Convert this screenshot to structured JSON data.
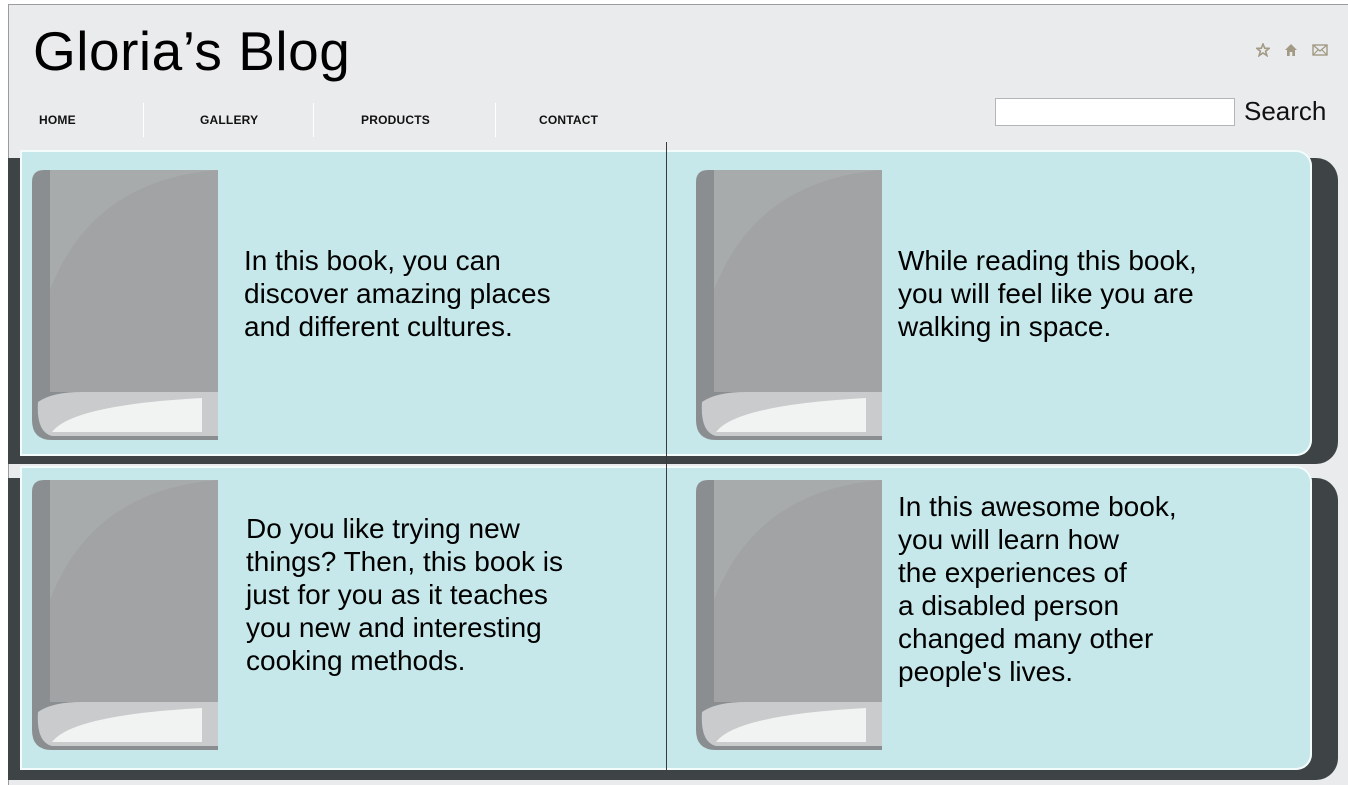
{
  "blog": {
    "title": "Gloria’s Blog"
  },
  "icons": [
    "star-icon",
    "home-icon",
    "mail-icon"
  ],
  "nav": {
    "items": [
      "HOME",
      "GALLERY",
      "PRODUCTS",
      "CONTACT"
    ]
  },
  "search": {
    "value": "",
    "placeholder": "",
    "button_label": "Search"
  },
  "cards": [
    {
      "text": "In this book, you can\ndiscover amazing places\nand different cultures."
    },
    {
      "text": "While reading this book,\nyou will feel like you are\nwalking in space."
    },
    {
      "text": "Do you like trying new\nthings? Then, this book is\njust for you as it teaches\nyou new and interesting\ncooking methods."
    },
    {
      "text": "In this awesome book,\nyou will learn how\nthe experiences of\na disabled person\nchanged many other\npeople's lives."
    }
  ],
  "colors": {
    "page_bg": "#eaebec",
    "card_bg": "#c6e8ea",
    "shadow": "#3e4346",
    "book_gray": "#a8abac",
    "icon_tan": "#a39a86"
  }
}
